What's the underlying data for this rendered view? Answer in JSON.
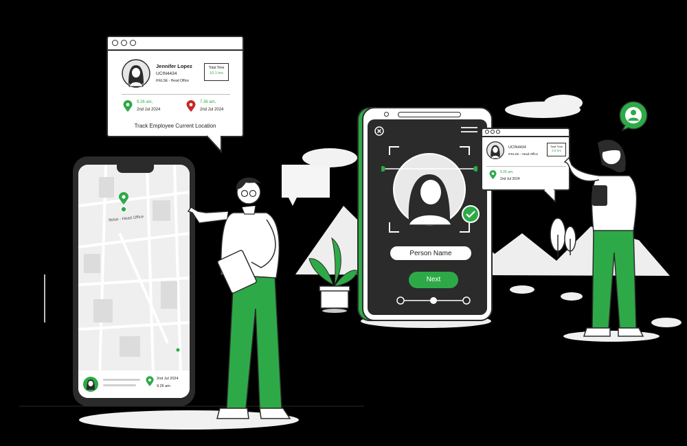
{
  "colors": {
    "accent": "#2daa47",
    "pin_red": "#c62828",
    "outline": "#2b2b2b",
    "background": "#000000"
  },
  "employee_card": {
    "name": "Jennifer Lopez",
    "id": "UCIN4434",
    "office": "IFELSE - Head Office",
    "total_time_label": "Total Time",
    "total_time_value": "10.1 hrs",
    "checkin_time": "9.26 am,",
    "checkin_date": "2nd Jul 2024",
    "checkout_time": "7.36 am,",
    "checkout_date": "2nd Jul 2024",
    "caption": "Track Employee Current Location"
  },
  "map_phone": {
    "location_label": "Ifelse - Head Office",
    "bottom_date": "2nd Jul 2024",
    "bottom_time": "9.26 am"
  },
  "face_phone": {
    "person_name_label": "Person Name",
    "next_label": "Next"
  },
  "small_card": {
    "id": "UCIN4434",
    "office": "IFELSE - Head Office",
    "total_time_label": "Total Time",
    "total_time_value": "3.5 hrs",
    "checkin_time": "9.26 am,",
    "checkin_date": "2nd Jul 2024"
  },
  "icons": [
    "location-pin-icon",
    "user-icon",
    "check-icon",
    "close-icon",
    "menu-icon"
  ]
}
